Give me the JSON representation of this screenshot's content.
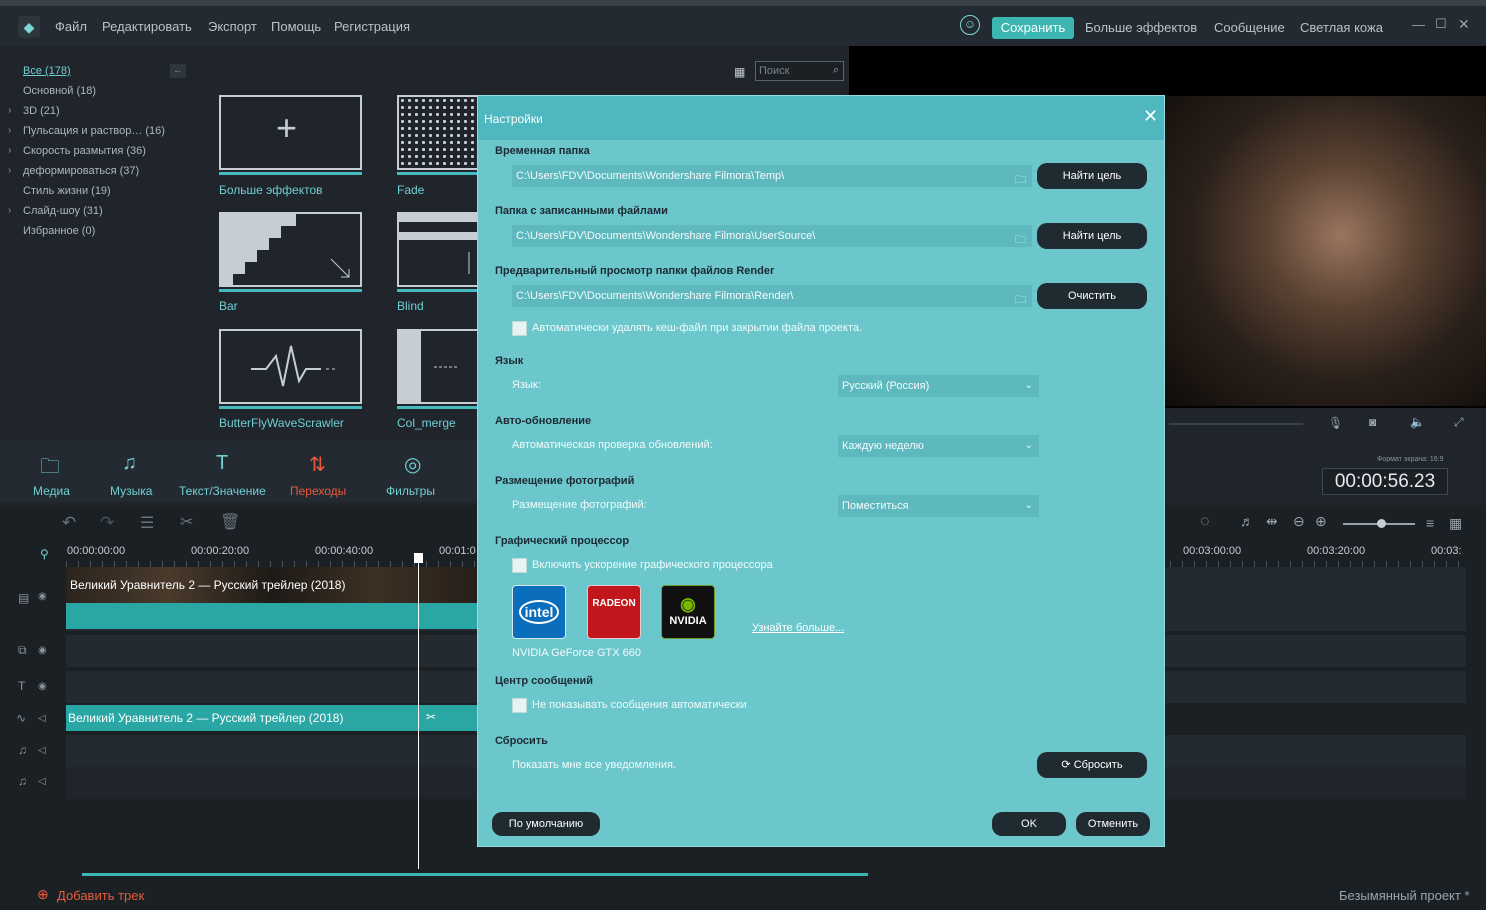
{
  "menu": {
    "items": [
      "Файл",
      "Редактировать",
      "Экспорт",
      "Помощь",
      "Регистрация"
    ],
    "save": "Сохранить",
    "more_effects": "Больше эффектов",
    "message": "Сообщение",
    "light_skin": "Светлая кожа"
  },
  "categories": {
    "all": "Все (178)",
    "items": [
      "Основной (18)",
      "3D (21)",
      "Пульсация и раствор… (16)",
      "Скорость размытия (36)",
      "деформироваться (37)",
      "Стиль жизни (19)",
      "Слайд-шоу (31)",
      "Избранное (0)"
    ]
  },
  "search": {
    "placeholder": "Поиск"
  },
  "tiles": [
    "Больше эффектов",
    "Fade",
    "Bar",
    "Blind",
    "ButterFlyWaveScrawler",
    "Col_merge"
  ],
  "tabs": [
    "Медиа",
    "Музыка",
    "Текст/Значение",
    "Переходы",
    "Фильтры"
  ],
  "timeline": {
    "ticks": [
      "00:00:00:00",
      "00:00:20:00",
      "00:00:40:00",
      "00:01:0",
      "00:03:00:00",
      "00:03:20:00",
      "00:03:"
    ],
    "video_clip": "Великий Уравнитель 2 — Русский трейлер (2018)",
    "audio_clip": "Великий Уравнитель 2 — Русский трейлер (2018)",
    "timecode": "00:00:56.23",
    "aspect": "Формат экрана: 16:9",
    "add_track": "Добавить трек",
    "project": "Безымянный проект *"
  },
  "dialog": {
    "title": "Настройки",
    "temp_label": "Временная папка",
    "temp_path": "C:\\Users\\FDV\\Documents\\Wondershare Filmora\\Temp\\",
    "find1": "Найти цель",
    "rec_label": "Папка с записанными файлами",
    "rec_path": "C:\\Users\\FDV\\Documents\\Wondershare Filmora\\UserSource\\",
    "find2": "Найти цель",
    "render_label": "Предварительный просмотр папки файлов Render",
    "render_path": "C:\\Users\\FDV\\Documents\\Wondershare Filmora\\Render\\",
    "clear": "Очистить",
    "auto_delete": "Автоматически удалять кеш-файл при закрытии файла проекта.",
    "lang_section": "Язык",
    "lang_label": "Язык:",
    "lang_value": "Русский (Россия)",
    "update_section": "Авто-обновление",
    "update_label": "Автоматическая проверка обновлений:",
    "update_value": "Каждую неделю",
    "photo_section": "Размещение фотографий",
    "photo_label": "Размещение фотографий:",
    "photo_value": "Поместиться",
    "gpu_section": "Графический процессор",
    "gpu_label": "Включить ускорение графического процессора",
    "learn_more": "Узнайте больше...",
    "gpu_name": "NVIDIA GeForce GTX 660",
    "msg_section": "Центр сообщений",
    "msg_label": "Не показывать сообщения автоматически",
    "reset_section": "Сбросить",
    "reset_label": "Показать мне все уведомления.",
    "reset_btn": "Сбросить",
    "default_btn": "По умолчанию",
    "ok_btn": "OK",
    "cancel_btn": "Отменить",
    "gpu_logos": [
      "intel",
      "RADEON",
      "NVIDIA"
    ]
  }
}
